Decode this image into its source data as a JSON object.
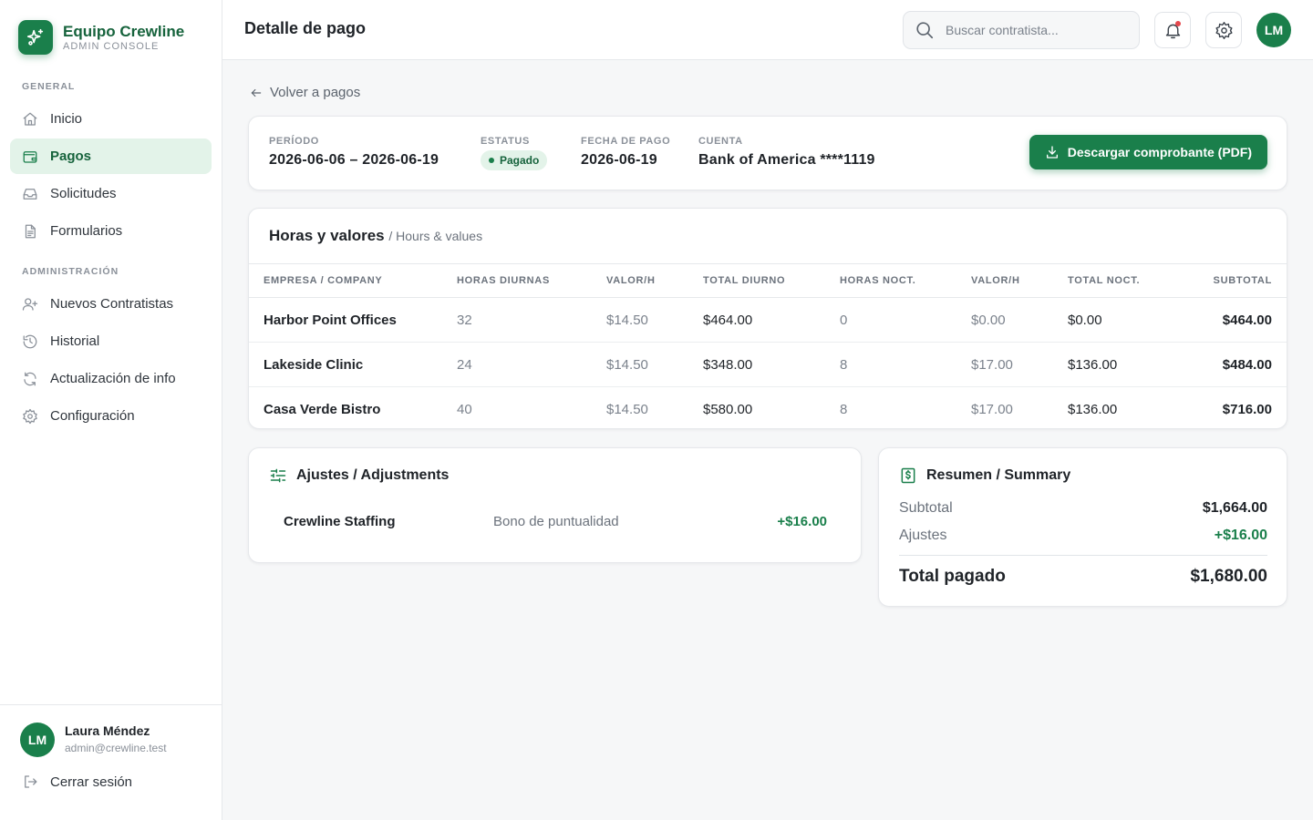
{
  "brand": {
    "name": "Equipo Crewline",
    "subtitle": "ADMIN CONSOLE"
  },
  "sidebar": {
    "sections": [
      {
        "title": "GENERAL",
        "items": [
          {
            "label": "Inicio",
            "icon": "home-icon",
            "active": false
          },
          {
            "label": "Pagos",
            "icon": "wallet-icon",
            "active": true
          },
          {
            "label": "Solicitudes",
            "icon": "inbox-icon",
            "active": false
          },
          {
            "label": "Formularios",
            "icon": "document-icon",
            "active": false
          }
        ]
      },
      {
        "title": "ADMINISTRACIÓN",
        "items": [
          {
            "label": "Nuevos Contratistas",
            "icon": "user-plus-icon",
            "active": false
          },
          {
            "label": "Historial",
            "icon": "history-icon",
            "active": false
          },
          {
            "label": "Actualización de info",
            "icon": "refresh-icon",
            "active": false
          },
          {
            "label": "Configuración",
            "icon": "gear-icon",
            "active": false
          }
        ]
      }
    ],
    "user": {
      "initials": "LM",
      "name": "Laura Méndez",
      "email": "admin@crewline.test"
    },
    "logout_label": "Cerrar sesión"
  },
  "header": {
    "title": "Detalle de pago",
    "search_placeholder": "Buscar contratista...",
    "avatar_initials": "LM"
  },
  "main": {
    "back_label": "Volver a pagos",
    "summary": {
      "period_label": "PERÍODO",
      "period_value": "2026-06-06 – 2026-06-19",
      "status_label": "ESTATUS",
      "status_value": "Pagado",
      "date_label": "FECHA DE PAGO",
      "date_value": "2026-06-19",
      "account_label": "CUENTA",
      "account_value": "Bank of America ****1119",
      "download_label": "Descargar comprobante (PDF)"
    },
    "hours": {
      "title": "Horas y valores",
      "subtitle": "/ Hours & values",
      "columns": [
        "EMPRESA / COMPANY",
        "HORAS DIURNAS",
        "VALOR/H",
        "TOTAL DIURNO",
        "HORAS NOCT.",
        "VALOR/H",
        "TOTAL NOCT.",
        "SUBTOTAL"
      ],
      "rows": [
        [
          "Harbor Point Offices",
          "32",
          "$14.50",
          "$464.00",
          "0",
          "$0.00",
          "$0.00",
          "$464.00"
        ],
        [
          "Lakeside Clinic",
          "24",
          "$14.50",
          "$348.00",
          "8",
          "$17.00",
          "$136.00",
          "$484.00"
        ],
        [
          "Casa Verde Bistro",
          "40",
          "$14.50",
          "$580.00",
          "8",
          "$17.00",
          "$136.00",
          "$716.00"
        ]
      ]
    },
    "adjustments": {
      "title": "Ajustes / Adjustments",
      "items": [
        {
          "company": "Crewline Staffing",
          "description": "Bono de puntualidad",
          "amount": "+$16.00"
        }
      ]
    },
    "summary_totals": {
      "title": "Resumen / Summary",
      "subtotal_label": "Subtotal",
      "subtotal_value": "$1,664.00",
      "adjustments_label": "Ajustes",
      "adjustments_value": "+$16.00",
      "total_label": "Total pagado",
      "total_value": "$1,680.00"
    }
  },
  "colors": {
    "accent": "#1a7f4b",
    "accent_light": "#e3f3e9",
    "notification": "#e5484d"
  }
}
